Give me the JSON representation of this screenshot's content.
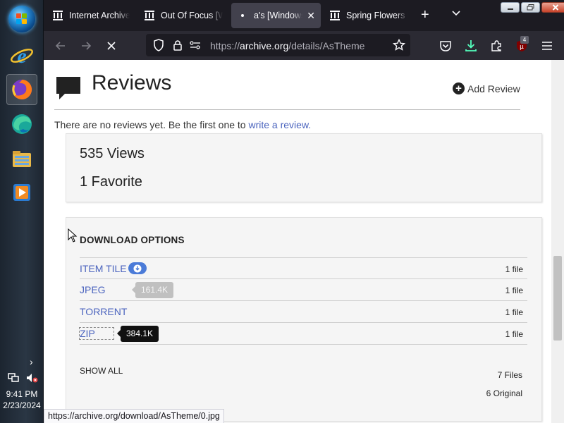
{
  "taskbar": {
    "apps": [
      "internet-explorer",
      "firefox",
      "edge",
      "file-explorer",
      "media-player"
    ],
    "clock_time": "9:41 PM",
    "clock_date": "2/23/2024"
  },
  "browser": {
    "tabs": [
      {
        "title": "Internet Archive",
        "icon": "archive-icon",
        "active": false
      },
      {
        "title": "Out Of Focus [W",
        "icon": "archive-icon",
        "active": false
      },
      {
        "title": "a's [Windows",
        "icon": "loading-icon",
        "active": true
      },
      {
        "title": "Spring Flowers [\\",
        "icon": "archive-icon",
        "active": false
      }
    ],
    "url_prefix": "https://",
    "url_host": "archive.org",
    "url_path": "/details/AsTheme",
    "ublock_badge": "4",
    "status_url": "https://archive.org/download/AsTheme/0.jpg"
  },
  "reviews": {
    "title": "Reviews",
    "add_label": "Add Review",
    "empty_text": "There are no reviews yet. Be the first one to ",
    "empty_link": "write a review."
  },
  "stats": {
    "views": "535 Views",
    "favorites": "1 Favorite"
  },
  "downloads": {
    "title": "DOWNLOAD OPTIONS",
    "rows": [
      {
        "label": "ITEM TILE",
        "count": "1 file"
      },
      {
        "label": "JPEG",
        "count": "1 file",
        "size": "161.4K"
      },
      {
        "label": "TORRENT",
        "count": "1 file"
      },
      {
        "label": "ZIP",
        "count": "1 file",
        "size": "384.1K"
      }
    ],
    "show_all": "SHOW ALL",
    "files_total": "7 Files",
    "files_original": "6 Original"
  },
  "colors": {
    "link": "#4b64be",
    "tab_strip": "#1c1b22",
    "nav_bar": "#2b2a33",
    "box_bg": "#f5f5f5"
  }
}
